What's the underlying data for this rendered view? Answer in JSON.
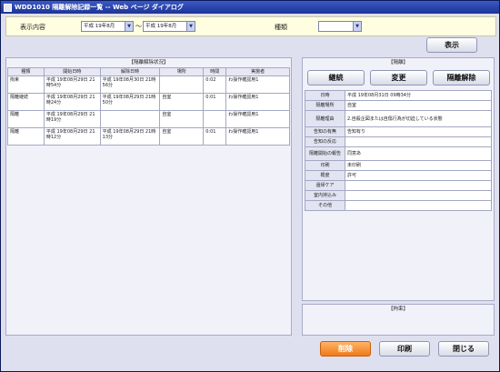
{
  "window": {
    "title": "WDD1010 隔離解除記録一覧 -- Web ページ ダイアログ"
  },
  "filter": {
    "display_label": "表示内容",
    "date_from": "平成 19年8月",
    "range_sep": "〜",
    "date_to": "平成 19年8月",
    "type_label": "種類",
    "type_value": "",
    "show_button": "表示"
  },
  "list_panel": {
    "title": "【隔離解除状況】",
    "columns": [
      "種類",
      "開始日時",
      "解除日時",
      "場所",
      "時間",
      "実施者"
    ],
    "rows": [
      {
        "type": "拘束",
        "start": "平成 19年08月29日 21時54分",
        "end": "平成 19年08月30日 21時56分",
        "place": "",
        "time": "0:02",
        "staff": "わ操作確認用1"
      },
      {
        "type": "隔離継続",
        "start": "平成 19年08月29日 21時24分",
        "end": "平成 19年08月29日 21時50分",
        "place": "自室",
        "time": "0:01",
        "staff": "わ操作確認用1"
      },
      {
        "type": "隔離",
        "start": "平成 19年08月29日 21時19分",
        "end": "",
        "place": "自室",
        "time": "",
        "staff": "わ操作確認用1"
      },
      {
        "type": "隔離",
        "start": "平成 19年08月29日 21時12分",
        "end": "平成 19年08月29日 21時13分",
        "place": "自室",
        "time": "0:01",
        "staff": "わ操作確認用1"
      }
    ]
  },
  "detail_panel": {
    "title": "【隔離】",
    "continue_button": "継続",
    "change_button": "変更",
    "release_button": "隔離解除",
    "fields": [
      {
        "label": "日時",
        "value": "平成 19年08月31日 09時34分"
      },
      {
        "label": "隔離場所",
        "value": "自室"
      },
      {
        "label": "隔離理由",
        "value": "2.自殺企図または自傷行為が切迫している状態"
      },
      {
        "label": "告知の有無",
        "value": "告知有り"
      },
      {
        "label": "告知の反応",
        "value": ""
      },
      {
        "label": "隔離開始の報告",
        "value": "同意あ"
      },
      {
        "label": "印刷",
        "value": "未印刷"
      },
      {
        "label": "概度",
        "value": "許可"
      },
      {
        "label": "還帰ケア",
        "value": ""
      },
      {
        "label": "室内持込み",
        "value": ""
      },
      {
        "label": "その他",
        "value": ""
      }
    ]
  },
  "restraint_panel": {
    "title": "【拘束】"
  },
  "footer": {
    "delete_button": "削除",
    "print_button": "印刷",
    "close_button": "閉じる"
  }
}
